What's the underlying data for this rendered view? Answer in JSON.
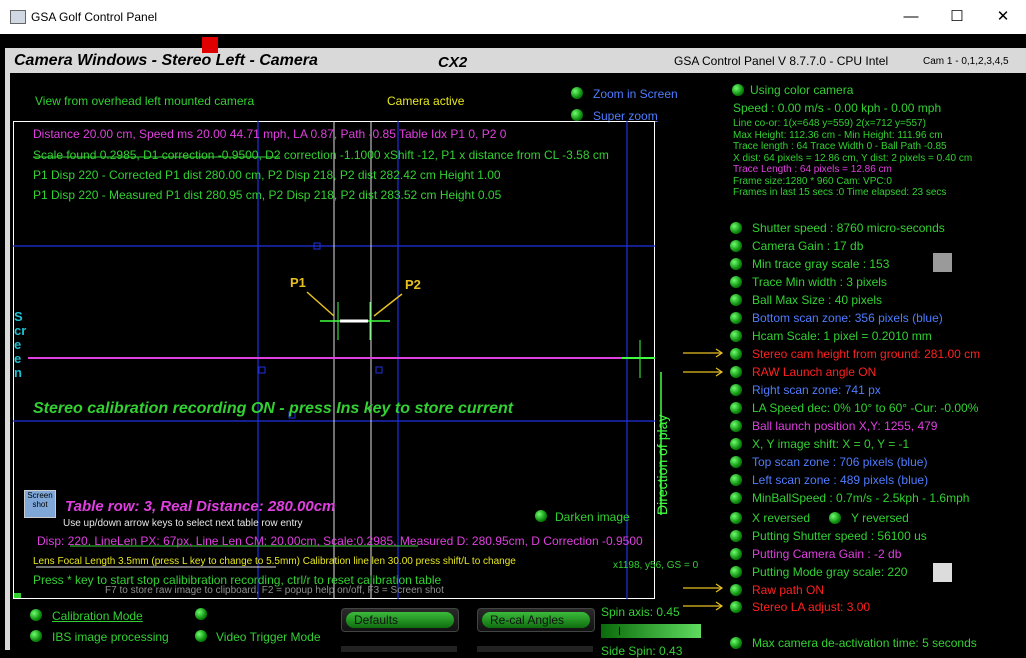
{
  "window": {
    "title": "GSA Golf Control Panel",
    "minimize": "—",
    "maximize": "☐",
    "close": "✕"
  },
  "header": {
    "left_title": "Camera Windows - Stereo Left - Camera",
    "center_title": "CX2",
    "version": "GSA Control Panel V 8.7.7.0 - CPU Intel",
    "cam": "Cam 1 - 0,1,2,3,4,5"
  },
  "colors": {
    "accent_green": "#33d033",
    "text_yellow": "#e8e820",
    "text_magenta": "#e040e0",
    "text_blue": "#4f7dff",
    "text_red": "#ff2020",
    "marker_red": "#e00000"
  },
  "view": {
    "overhead_label": "View from overhead left mounted camera",
    "camera_active": "Camera active",
    "zoom_in_screen": "Zoom in Screen",
    "super_zoom": "Super zoom",
    "line1": "Distance 20.00 cm, Speed ms 20.00 44.71 mph, LA 0.87, Path -0.85 Table Idx P1 0, P2 0",
    "line2": "Scale found 0.2985, D1 correction -0.9500, D2 correction -1.1000 xShift -12, P1 x distance from CL -3.58 cm",
    "line3": "P1 Disp 220 - Corrected P1 dist 280.00 cm, P2 Disp 218, P2 dist 282.42 cm Height 1.00",
    "line4": "P1 Disp 220 - Measured P1 dist 280.95 cm, P2 Disp 218, P2 dist 283.52 cm Height 0.05",
    "p1": "P1",
    "p2": "P2",
    "screen_vertical": "Screen",
    "direction_of_play": "Direction of play",
    "stereo_recording": "Stereo calibration recording ON - press Ins key to store current",
    "screenshot_icon": "Screen shot",
    "table_row": "Table row: 3, Real Distance: 280.00cm",
    "table_hint": "Use up/down arrow keys to select next table row entry",
    "darken_image": "Darken image",
    "disp_line": "Disp: 220, LineLen PX: 67px, Line Len CM: 20.00cm, Scale:0.2985, Measured D: 280.95cm, D Correction -0.9500",
    "lens_line": "Lens Focal Length 3.5mm (press L key to change to 5.5mm) Calibration line len 30.00 press shift/L to change",
    "coords": "x1198, y56, GS = 0",
    "press_star": "Press * key to start stop calibibration recording, ctrl/r to reset calibration table",
    "f7_hint": "F7 to store raw image to clipboard, F2 = popup help on/off, F3 = Screen shot"
  },
  "bottom": {
    "calibration_mode": "Calibration Mode",
    "ibs_processing": "IBS image processing",
    "video_trigger": "Video Trigger Mode",
    "defaults": "Defaults",
    "recal_angles": "Re-cal Angles",
    "spin_axis": "Spin axis: 0.45",
    "side_spin": "Side Spin: 0.43"
  },
  "right": {
    "using_color_camera": "Using color camera",
    "speed": "Speed : 0.00 m/s - 0.00 kph - 0.00 mph",
    "info": [
      "Line co-or: 1(x=648 y=559) 2(x=712 y=557)",
      "Max Height: 112.36 cm - Min Height: 111.96 cm",
      "Trace length : 64 Trace Width 0 - Ball Path -0.85",
      "X dist: 64 pixels = 12.86 cm, Y dist: 2 pixels = 0.40 cm",
      "Trace Length : 64 pixels = 12.86 cm",
      "Frame size:1280 * 960 Cam:  VPC:0",
      "Frames in last 15 secs :0 Time elapsed:  23 secs"
    ],
    "settings": [
      {
        "label": "Shutter speed : 8760 micro-seconds",
        "color": "#33d033"
      },
      {
        "label": "Camera Gain : 17 db",
        "color": "#33d033"
      },
      {
        "label": "Min trace gray scale : 153",
        "color": "#33d033"
      },
      {
        "label": "Trace Min width : 3 pixels",
        "color": "#33d033"
      },
      {
        "label": "Ball Max Size : 40 pixels",
        "color": "#33d033"
      },
      {
        "label": "Bottom scan zone: 356 pixels (blue)",
        "color": "#4f7dff"
      },
      {
        "label": "Hcam Scale: 1 pixel = 0.2010 mm",
        "color": "#33d033"
      },
      {
        "label": "Stereo cam height from ground: 281.00 cm",
        "color": "#ff2020"
      },
      {
        "label": "RAW Launch angle ON",
        "color": "#ff2020"
      },
      {
        "label": "Right scan zone: 741 px",
        "color": "#4f7dff"
      },
      {
        "label": "LA Speed dec: 0% 10° to 60° -Cur: -0.00%",
        "color": "#33d033"
      },
      {
        "label": "Ball launch position X,Y: 1255, 479",
        "color": "#e040e0"
      },
      {
        "label": "X, Y image shift: X = 0, Y = -1",
        "color": "#33d033"
      },
      {
        "label": "Top scan zone : 706 pixels (blue)",
        "color": "#4f7dff"
      },
      {
        "label": "Left scan zone : 489 pixels (blue)",
        "color": "#4f7dff"
      },
      {
        "label": "MinBallSpeed : 0.7m/s - 2.5kph - 1.6mph",
        "color": "#33d033"
      },
      {
        "label": "X reversed",
        "color": "#33d033"
      },
      {
        "label": "Putting Shutter speed : 56100 us",
        "color": "#33d033"
      },
      {
        "label": "Putting Camera Gain : -2 db",
        "color": "#e040e0"
      },
      {
        "label": "Putting Mode gray scale: 220",
        "color": "#33d033"
      },
      {
        "label": "Raw path ON",
        "color": "#ff2020"
      },
      {
        "label": "Stereo LA adjust: 3.00",
        "color": "#ff2020"
      },
      {
        "label": "Max camera de-activation time: 5 seconds",
        "color": "#33d033"
      }
    ],
    "y_reversed": "Y reversed"
  }
}
